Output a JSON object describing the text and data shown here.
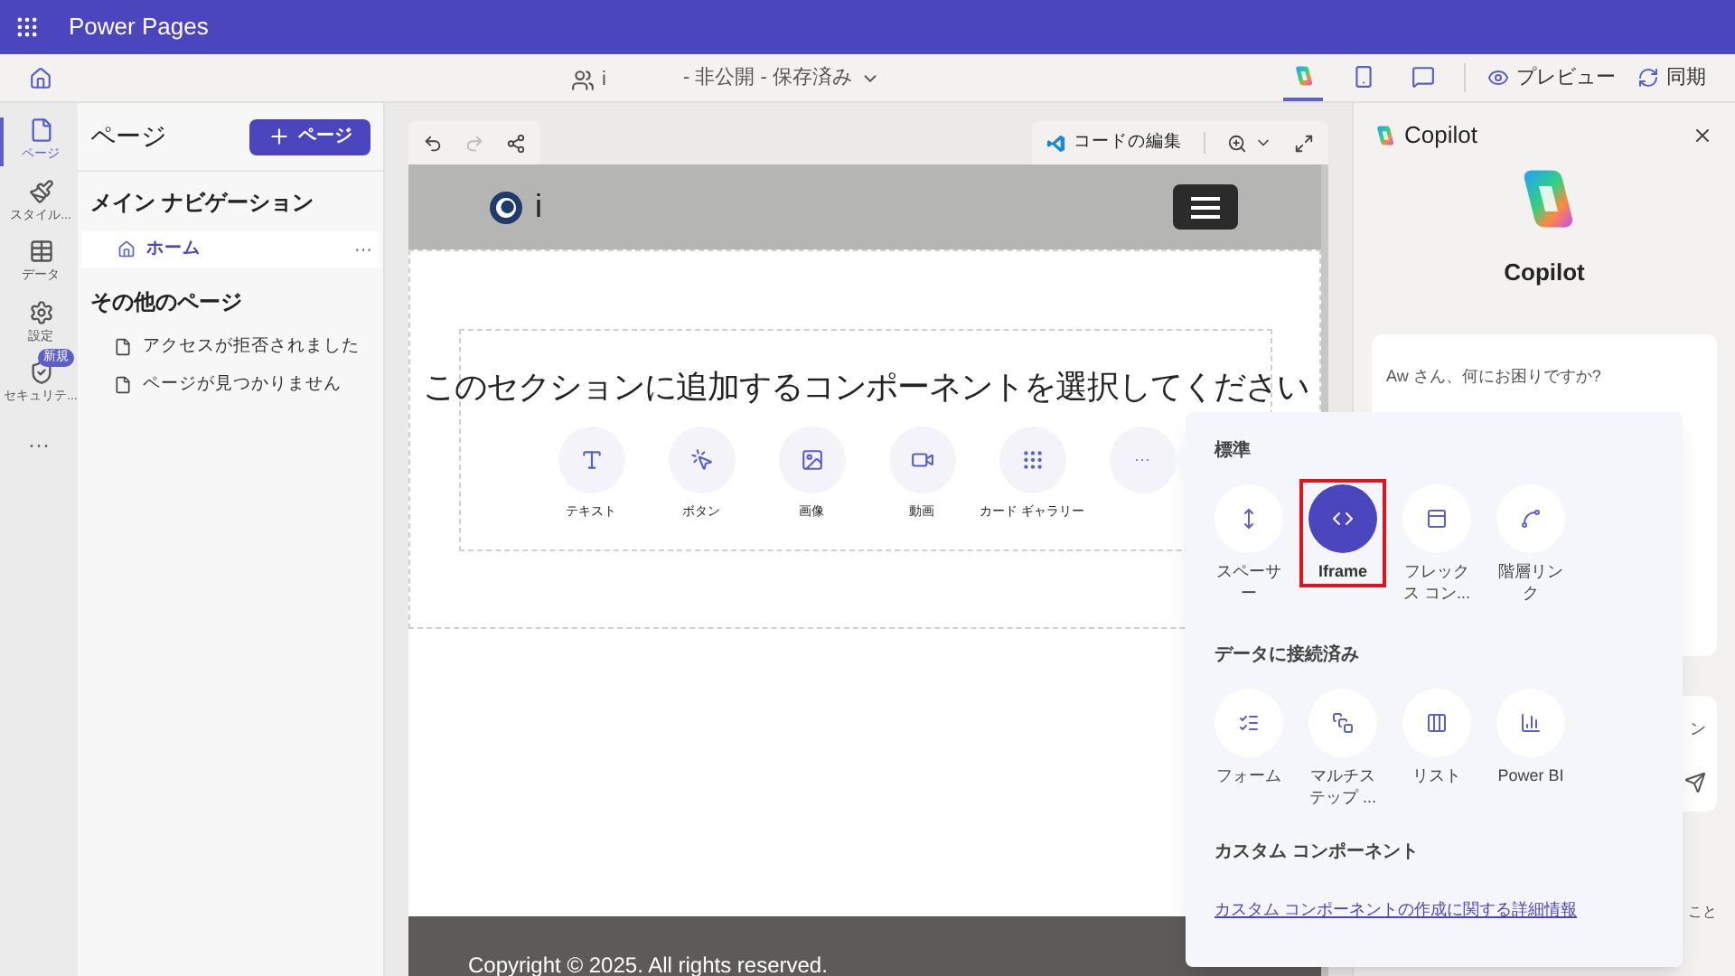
{
  "app_bar": {
    "title": "Power Pages"
  },
  "command_bar": {
    "site_name": "i",
    "status": "- 非公開 - 保存済み",
    "icon_actions": [
      {
        "kind": "copilot",
        "selected": true
      },
      {
        "kind": "mobile",
        "selected": false
      },
      {
        "kind": "comment",
        "selected": false
      }
    ],
    "text_actions": [
      {
        "kind": "preview",
        "label": "プレビュー"
      },
      {
        "kind": "sync",
        "label": "同期"
      }
    ]
  },
  "rail": {
    "items": [
      {
        "kind": "pages",
        "label": "ページ",
        "selected": true
      },
      {
        "kind": "styling",
        "label": "スタイル...",
        "selected": false
      },
      {
        "kind": "data",
        "label": "データ",
        "selected": false
      },
      {
        "kind": "setup",
        "label": "設定",
        "selected": false
      },
      {
        "kind": "security",
        "label": "セキュリテ...",
        "selected": false,
        "badge": "新規"
      }
    ],
    "more": "···"
  },
  "pages_panel": {
    "title": "ページ",
    "add_button": "ページ",
    "main_nav_title": "メイン ナビゲーション",
    "main_nav": [
      {
        "label": "ホーム",
        "selected": true,
        "more": "···"
      }
    ],
    "other_title": "その他のページ",
    "other_pages": [
      "アクセスが拒否されました",
      "ページが見つかりません"
    ]
  },
  "canvas_toolbar": {
    "edit_code": "コードの編集"
  },
  "preview": {
    "site_name": "i",
    "section_prompt": "このセクションに追加するコンポーネントを選択してください",
    "components": [
      {
        "kind": "text",
        "label": "テキスト"
      },
      {
        "kind": "button",
        "label": "ボタン"
      },
      {
        "kind": "image",
        "label": "画像"
      },
      {
        "kind": "video",
        "label": "動画"
      },
      {
        "kind": "gallery",
        "label": "カード ギャラリー"
      },
      {
        "kind": "more",
        "label": "···"
      }
    ],
    "footer": "Copyright © 2025. All rights reserved."
  },
  "popover": {
    "sections": [
      {
        "title": "標準",
        "items": [
          {
            "kind": "spacer",
            "label": "スペーサー",
            "selected": false
          },
          {
            "kind": "iframe",
            "label": "Iframe",
            "selected": true
          },
          {
            "kind": "flex",
            "label": "フレックス コン...",
            "selected": false
          },
          {
            "kind": "breadcrumb",
            "label": "階層リンク",
            "selected": false
          }
        ]
      },
      {
        "title": "データに接続済み",
        "items": [
          {
            "kind": "form",
            "label": "フォーム",
            "selected": false
          },
          {
            "kind": "multistep",
            "label": "マルチステップ ...",
            "selected": false
          },
          {
            "kind": "list",
            "label": "リスト",
            "selected": false
          },
          {
            "kind": "powerbi",
            "label": "Power BI",
            "selected": false
          }
        ]
      }
    ],
    "custom_title": "カスタム コンポーネント",
    "link": "カスタム コンポーネントの作成に関する詳細情報"
  },
  "copilot": {
    "title": "Copilot",
    "hero": "Copilot",
    "greeting": "Aw さん、何にお困りですか?",
    "fragment_1": "ン",
    "fragment_2": "こと"
  }
}
